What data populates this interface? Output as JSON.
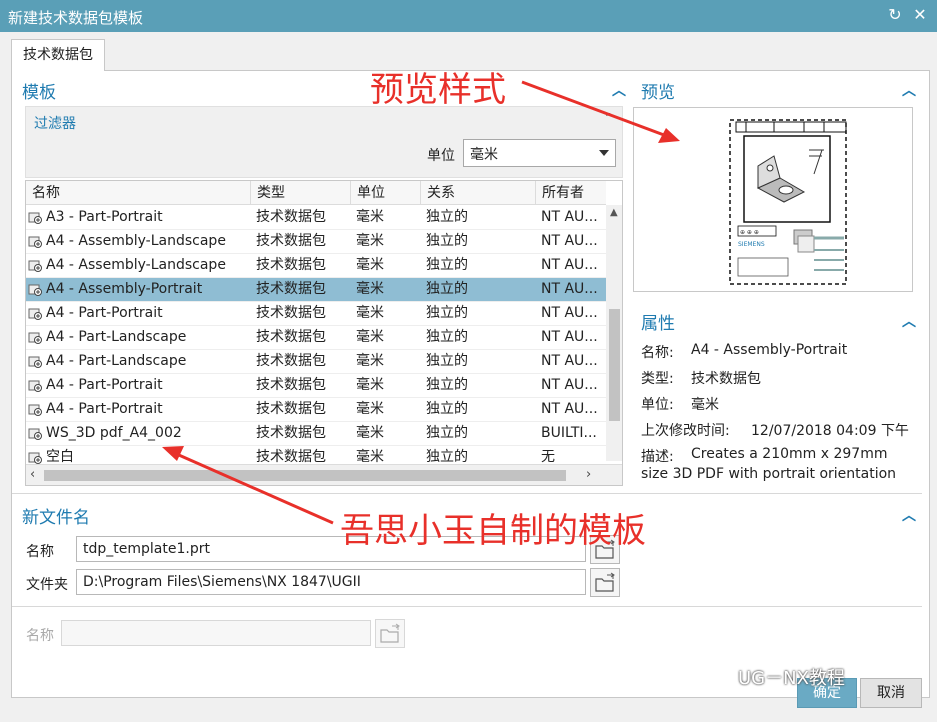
{
  "window": {
    "title": "新建技术数据包模板"
  },
  "tab": {
    "label": "技术数据包"
  },
  "templates": {
    "title": "模板",
    "filter": {
      "title": "过滤器",
      "unit_label": "单位",
      "unit_value": "毫米"
    },
    "columns": [
      "名称",
      "类型",
      "单位",
      "关系",
      "所有者"
    ],
    "rows": [
      {
        "name": "A3 - Part-Portrait",
        "type": "技术数据包",
        "unit": "毫米",
        "relation": "独立的",
        "owner": "NT AU..."
      },
      {
        "name": "A4 - Assembly-Landscape",
        "type": "技术数据包",
        "unit": "毫米",
        "relation": "独立的",
        "owner": "NT AU..."
      },
      {
        "name": "A4 - Assembly-Landscape",
        "type": "技术数据包",
        "unit": "毫米",
        "relation": "独立的",
        "owner": "NT AU..."
      },
      {
        "name": "A4 - Assembly-Portrait",
        "type": "技术数据包",
        "unit": "毫米",
        "relation": "独立的",
        "owner": "NT AU..."
      },
      {
        "name": "A4 - Part-Portrait",
        "type": "技术数据包",
        "unit": "毫米",
        "relation": "独立的",
        "owner": "NT AU..."
      },
      {
        "name": "A4 - Part-Landscape",
        "type": "技术数据包",
        "unit": "毫米",
        "relation": "独立的",
        "owner": "NT AU..."
      },
      {
        "name": "A4 - Part-Landscape",
        "type": "技术数据包",
        "unit": "毫米",
        "relation": "独立的",
        "owner": "NT AU..."
      },
      {
        "name": "A4 - Part-Portrait",
        "type": "技术数据包",
        "unit": "毫米",
        "relation": "独立的",
        "owner": "NT AU..."
      },
      {
        "name": "A4 - Part-Portrait",
        "type": "技术数据包",
        "unit": "毫米",
        "relation": "独立的",
        "owner": "NT AU..."
      },
      {
        "name": "WS_3D pdf_A4_002",
        "type": "技术数据包",
        "unit": "毫米",
        "relation": "独立的",
        "owner": "BUILTI..."
      },
      {
        "name": "空白",
        "type": "技术数据包",
        "unit": "毫米",
        "relation": "独立的",
        "owner": "无"
      }
    ],
    "selected_index": 3
  },
  "preview": {
    "title": "预览",
    "logo_text": "SIEMENS"
  },
  "properties": {
    "title": "属性",
    "name_label": "名称:",
    "name_value": "A4 - Assembly-Portrait",
    "type_label": "类型:",
    "type_value": "技术数据包",
    "unit_label": "单位:",
    "unit_value": "毫米",
    "modified_label": "上次修改时间:",
    "modified_value": "12/07/2018 04:09 下午",
    "desc_label": "描述:",
    "desc_line1": "Creates a 210mm x 297mm",
    "desc_line2": "size 3D PDF with portrait orientation"
  },
  "new_file": {
    "title": "新文件名",
    "name_label": "名称",
    "name_value": "tdp_template1.prt",
    "folder_label": "文件夹",
    "folder_value": "D:\\Program Files\\Siemens\\NX 1847\\UGII",
    "disabled_name_label": "名称"
  },
  "buttons": {
    "ok": "确定",
    "cancel": "取消"
  },
  "annotations": {
    "preview_style": "预览样式",
    "custom_template": "吾思小玉自制的模板"
  },
  "watermark": "UG－NX教程",
  "colors": {
    "titlebar": "#5a9fb7",
    "accent": "#1f7bb0",
    "selection": "#8fbdd3",
    "annotation": "#e8302a"
  }
}
